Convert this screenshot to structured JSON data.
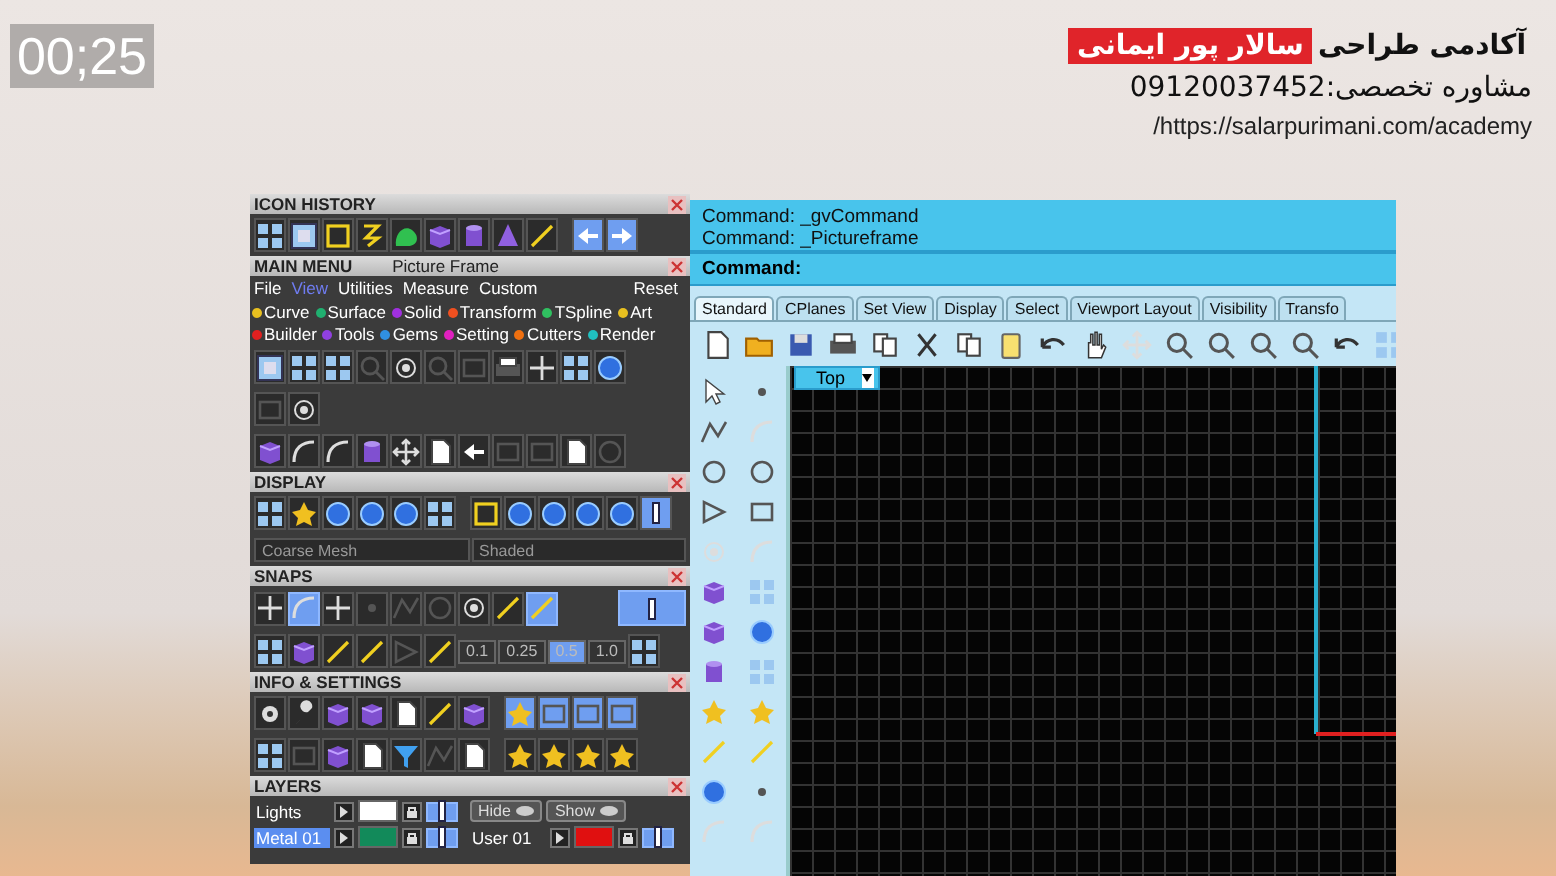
{
  "video": {
    "timestamp": "00;25"
  },
  "branding": {
    "academy": "آکادمی طراحی",
    "name": "سالار پور ایمانی",
    "consult": "مشاوره تخصصی:09120037452",
    "url": "/https://salarpurimani.com/academy"
  },
  "panel": {
    "icon_history": {
      "title": "ICON HISTORY"
    },
    "main_menu": {
      "title": "MAIN MENU",
      "current": "Picture Frame",
      "reset": "Reset",
      "menu": [
        {
          "label": "File",
          "selected": false
        },
        {
          "label": "View",
          "selected": true
        },
        {
          "label": "Utilities",
          "selected": false
        },
        {
          "label": "Measure",
          "selected": false
        },
        {
          "label": "Custom",
          "selected": false
        }
      ],
      "categories": [
        {
          "label": "Curve",
          "color": "#e8c020"
        },
        {
          "label": "Surface",
          "color": "#20b070"
        },
        {
          "label": "Solid",
          "color": "#a030e0"
        },
        {
          "label": "Transform",
          "color": "#f05020"
        },
        {
          "label": "TSpline",
          "color": "#30c060"
        },
        {
          "label": "Art",
          "color": "#e8c020"
        },
        {
          "label": "Builder",
          "color": "#e02020"
        },
        {
          "label": "Tools",
          "color": "#9040e0"
        },
        {
          "label": "Gems",
          "color": "#3090e0"
        },
        {
          "label": "Setting",
          "color": "#e020c0"
        },
        {
          "label": "Cutters",
          "color": "#f07010"
        },
        {
          "label": "Render",
          "color": "#20c0c0"
        }
      ]
    },
    "display": {
      "title": "DISPLAY",
      "mesh": "Coarse Mesh",
      "mode": "Shaded"
    },
    "snaps": {
      "title": "SNAPS",
      "toggles": [
        {
          "on": false
        },
        {
          "on": true
        },
        {
          "on": false
        },
        {
          "on": false
        },
        {
          "on": false
        },
        {
          "on": false
        },
        {
          "on": false
        },
        {
          "on": false
        },
        {
          "on": true
        }
      ],
      "tolerances": [
        {
          "label": "0.1",
          "selected": false
        },
        {
          "label": "0.25",
          "selected": false
        },
        {
          "label": "0.5",
          "selected": true
        },
        {
          "label": "1.0",
          "selected": false
        }
      ]
    },
    "info": {
      "title": "INFO & SETTINGS"
    },
    "layers": {
      "title": "LAYERS",
      "hide": "Hide",
      "show": "Show",
      "items": [
        {
          "name": "Lights",
          "color": "#ffffff",
          "selected": false,
          "visible": true
        },
        {
          "name": "Metal 01",
          "color": "#128a5a",
          "selected": true,
          "visible": true
        },
        {
          "name": "User 01",
          "color": "#e01010",
          "selected": false,
          "visible": true
        }
      ]
    }
  },
  "rhino": {
    "history": [
      "Command: _gvCommand",
      "Command: _Pictureframe"
    ],
    "prompt": "Command:",
    "tabs": [
      {
        "label": "Standard",
        "selected": true
      },
      {
        "label": "CPlanes",
        "selected": false
      },
      {
        "label": "Set View",
        "selected": false
      },
      {
        "label": "Display",
        "selected": false
      },
      {
        "label": "Select",
        "selected": false
      },
      {
        "label": "Viewport Layout",
        "selected": false
      },
      {
        "label": "Visibility",
        "selected": false
      },
      {
        "label": "Transfo",
        "selected": false
      }
    ],
    "viewport": {
      "title": "Top"
    }
  }
}
